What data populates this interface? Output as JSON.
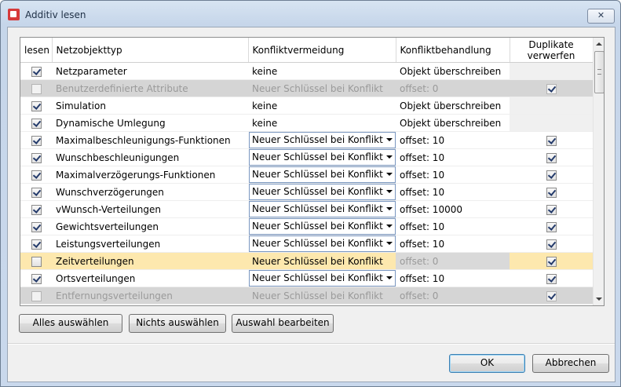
{
  "window": {
    "title": "Additiv lesen",
    "close_symbol": "✕"
  },
  "columns": {
    "lesen": "lesen",
    "typ": "Netzobjekttyp",
    "vermeidung": "Konfliktvermeidung",
    "behandlung": "Konfliktbehandlung",
    "duplikate_l1": "Duplikate",
    "duplikate_l2": "verwerfen"
  },
  "rows": [
    {
      "lesen": true,
      "enabled": true,
      "type": "Netzparameter",
      "vermeidung": "keine",
      "vermeidung_combo": false,
      "behandlung": "Objekt überschreiben",
      "duplikate": null
    },
    {
      "lesen": false,
      "enabled": false,
      "type": "Benutzerdefinierte Attribute",
      "vermeidung": "Neuer Schlüssel bei Konflikt",
      "vermeidung_combo": false,
      "behandlung": "offset: 0",
      "duplikate": true
    },
    {
      "lesen": true,
      "enabled": true,
      "type": "Simulation",
      "vermeidung": "keine",
      "vermeidung_combo": false,
      "behandlung": "Objekt überschreiben",
      "duplikate": null
    },
    {
      "lesen": true,
      "enabled": true,
      "type": "Dynamische Umlegung",
      "vermeidung": "keine",
      "vermeidung_combo": false,
      "behandlung": "Objekt überschreiben",
      "duplikate": null
    },
    {
      "lesen": true,
      "enabled": true,
      "type": "Maximalbeschleunigungs-Funktionen",
      "vermeidung": "Neuer Schlüssel bei Konflikt",
      "vermeidung_combo": true,
      "behandlung": "offset: 10",
      "duplikate": true
    },
    {
      "lesen": true,
      "enabled": true,
      "type": "Wunschbeschleunigungen",
      "vermeidung": "Neuer Schlüssel bei Konflikt",
      "vermeidung_combo": true,
      "behandlung": "offset: 10",
      "duplikate": true
    },
    {
      "lesen": true,
      "enabled": true,
      "type": "Maximalverzögerungs-Funktionen",
      "vermeidung": "Neuer Schlüssel bei Konflikt",
      "vermeidung_combo": true,
      "behandlung": "offset: 10",
      "duplikate": true
    },
    {
      "lesen": true,
      "enabled": true,
      "type": "Wunschverzögerungen",
      "vermeidung": "Neuer Schlüssel bei Konflikt",
      "vermeidung_combo": true,
      "behandlung": "offset: 10",
      "duplikate": true
    },
    {
      "lesen": true,
      "enabled": true,
      "type": "vWunsch-Verteilungen",
      "vermeidung": "Neuer Schlüssel bei Konflikt",
      "vermeidung_combo": true,
      "behandlung": "offset: 10000",
      "duplikate": true
    },
    {
      "lesen": true,
      "enabled": true,
      "type": "Gewichtsverteilungen",
      "vermeidung": "Neuer Schlüssel bei Konflikt",
      "vermeidung_combo": true,
      "behandlung": "offset: 10",
      "duplikate": true
    },
    {
      "lesen": true,
      "enabled": true,
      "type": "Leistungsverteilungen",
      "vermeidung": "Neuer Schlüssel bei Konflikt",
      "vermeidung_combo": true,
      "behandlung": "offset: 10",
      "duplikate": true
    },
    {
      "lesen": false,
      "enabled": true,
      "highlight": true,
      "type": "Zeitverteilungen",
      "vermeidung": "Neuer Schlüssel bei Konflikt",
      "vermeidung_combo": false,
      "behandlung": "offset: 0",
      "behandlung_gray": true,
      "duplikate": true
    },
    {
      "lesen": true,
      "enabled": true,
      "type": "Ortsverteilungen",
      "vermeidung": "Neuer Schlüssel bei Konflikt",
      "vermeidung_combo": true,
      "behandlung": "offset: 10",
      "duplikate": true
    },
    {
      "lesen": false,
      "enabled": false,
      "type": "Entfernungsverteilungen",
      "vermeidung": "Neuer Schlüssel bei Konflikt",
      "vermeidung_combo": false,
      "behandlung": "offset: 0",
      "duplikate": true
    }
  ],
  "buttons": {
    "select_all": "Alles auswählen",
    "select_none": "Nichts auswählen",
    "edit_selection": "Auswahl bearbeiten",
    "ok": "OK",
    "cancel": "Abbrechen"
  },
  "colors": {
    "highlight_row": "#fde8ae",
    "disabled_row": "#d5d5d5"
  }
}
